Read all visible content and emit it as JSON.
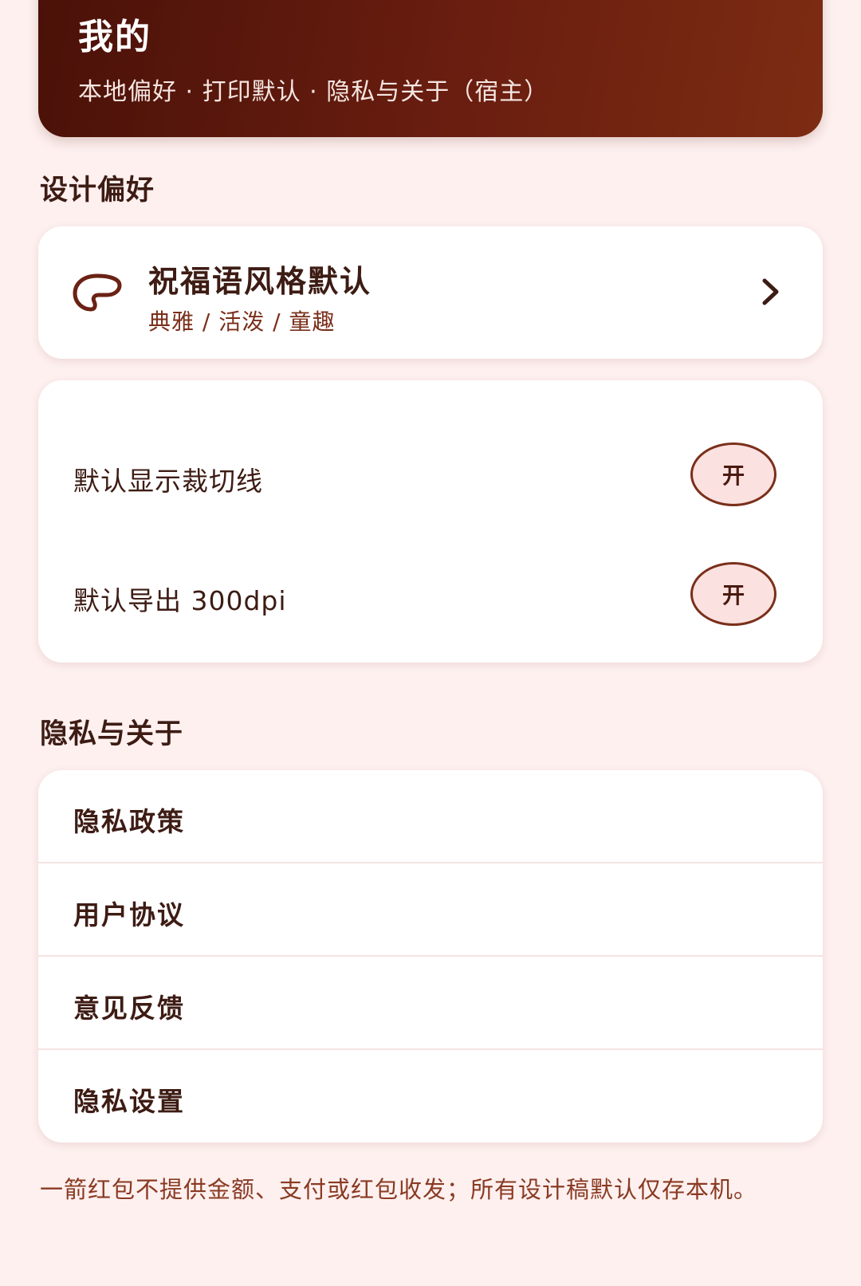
{
  "header": {
    "title": "我的",
    "subtitle": "本地偏好 · 打印默认 · 隐私与关于（宿主）"
  },
  "design_section": {
    "title": "设计偏好",
    "style_card": {
      "icon": "palette-icon",
      "title": "祝福语风格默认",
      "subtitle": "典雅 / 活泼 / 童趣",
      "chevron": "chevron-right-icon"
    },
    "toggles": [
      {
        "label": "默认显示裁切线",
        "state": "开"
      },
      {
        "label": "默认导出 300dpi",
        "state": "开"
      }
    ]
  },
  "privacy_section": {
    "title": "隐私与关于",
    "items": [
      {
        "label": "隐私政策"
      },
      {
        "label": "用户协议"
      },
      {
        "label": "意见反馈"
      },
      {
        "label": "隐私设置"
      }
    ]
  },
  "footer": {
    "note": "一箭红包不提供金额、支付或红包收发；所有设计稿默认仅存本机。"
  },
  "colors": {
    "background": "#fdf0ef",
    "header_gradient_start": "#4a1108",
    "header_gradient_end": "#7d2c12",
    "accent": "#7a2f1a",
    "toggle_fill": "#fbe1df"
  }
}
